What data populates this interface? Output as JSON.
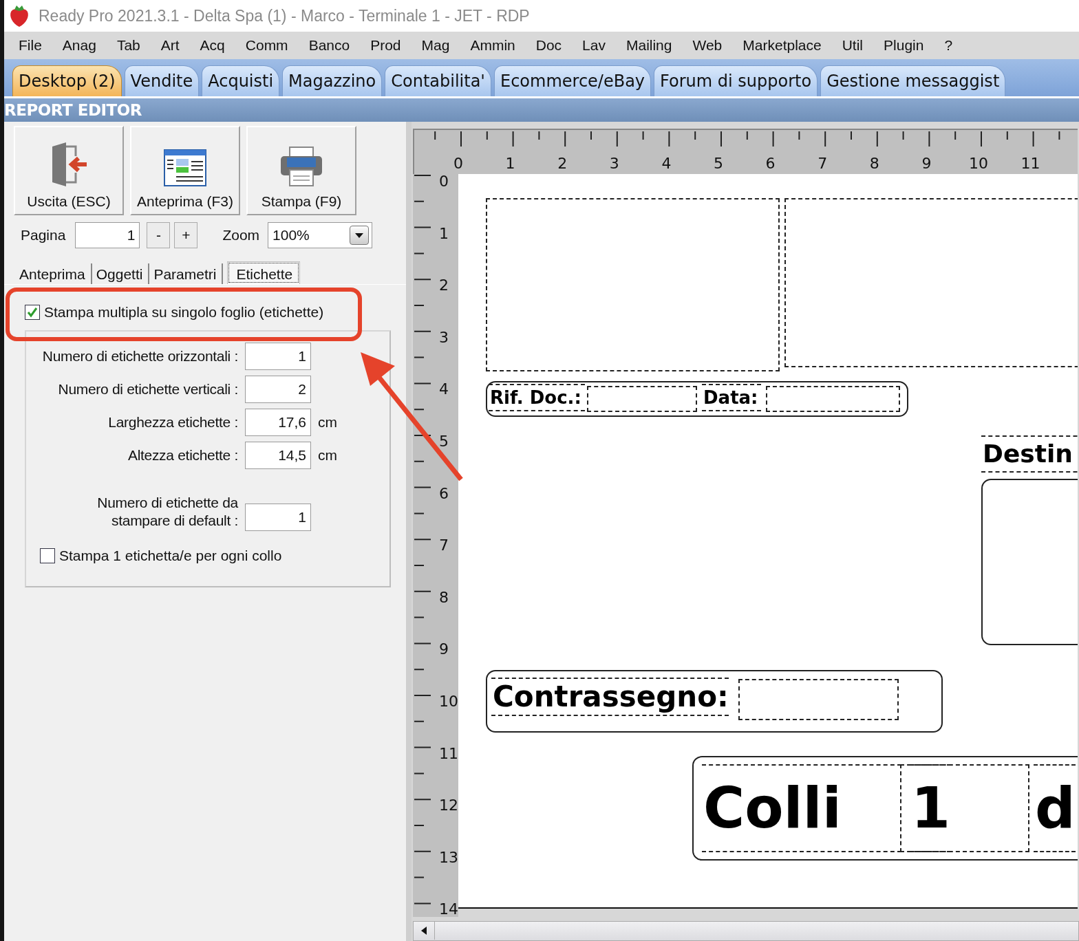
{
  "window": {
    "title": "Ready Pro 2021.3.1 - Delta Spa (1) - Marco - Terminale 1 - JET - RDP"
  },
  "menu": [
    "File",
    "Anag",
    "Tab",
    "Art",
    "Acq",
    "Comm",
    "Banco",
    "Prod",
    "Mag",
    "Ammin",
    "Doc",
    "Lav",
    "Mailing",
    "Web",
    "Marketplace",
    "Util",
    "Plugin",
    "?"
  ],
  "tabs": [
    {
      "label": "Desktop (2)",
      "selected": true
    },
    {
      "label": "Vendite",
      "selected": false
    },
    {
      "label": "Acquisti",
      "selected": false
    },
    {
      "label": "Magazzino",
      "selected": false
    },
    {
      "label": "Contabilita'",
      "selected": false
    },
    {
      "label": "Ecommerce/eBay",
      "selected": false
    },
    {
      "label": "Forum di supporto",
      "selected": false
    },
    {
      "label": "Gestione messaggist",
      "selected": false
    }
  ],
  "section_title": "REPORT EDITOR",
  "toolbar": [
    {
      "kind": "exit",
      "label": "Uscita (ESC)"
    },
    {
      "kind": "preview",
      "label": "Anteprima (F3)"
    },
    {
      "kind": "print",
      "label": "Stampa (F9)"
    }
  ],
  "page_controls": {
    "page_label": "Pagina",
    "page_value": "1",
    "decrement": "-",
    "increment": "+",
    "zoom_label": "Zoom",
    "zoom_value": "100%"
  },
  "panel_tabs": [
    {
      "label": "Anteprima",
      "selected": false
    },
    {
      "label": "Oggetti",
      "selected": false
    },
    {
      "label": "Parametri",
      "selected": false
    },
    {
      "label": "Etichette",
      "selected": true
    }
  ],
  "multi_print": {
    "label": "Stampa multipla su singolo foglio (etichette)",
    "checked": true
  },
  "label_fields": [
    {
      "label": "Numero di etichette orizzontali :",
      "value": "1"
    },
    {
      "label": "Numero di etichette verticali :",
      "value": "2"
    },
    {
      "label": "Larghezza etichette :",
      "value": "17,6",
      "unit": "cm"
    },
    {
      "label": "Altezza etichette :",
      "value": "14,5",
      "unit": "cm"
    },
    {
      "label": "Numero di etichette da\nstampare di default :",
      "value": "1"
    }
  ],
  "per_package": {
    "label": "Stampa 1 etichetta/e per ogni collo",
    "checked": false
  },
  "ruler": {
    "horizontal": [
      "0",
      "1",
      "2",
      "3",
      "4",
      "5",
      "6",
      "7",
      "8",
      "9",
      "10",
      "11"
    ],
    "vertical": [
      "0",
      "1",
      "2",
      "3",
      "4",
      "5",
      "6",
      "7",
      "8",
      "9",
      "10",
      "11",
      "12",
      "13",
      "14"
    ]
  },
  "report_objects": [
    {
      "kind": "frame"
    },
    {
      "kind": "frame"
    },
    {
      "kind": "group"
    },
    {
      "kind": "text",
      "text": "Rif. Doc.:"
    },
    {
      "kind": "frame"
    },
    {
      "kind": "text",
      "text": "Data:"
    },
    {
      "kind": "frame"
    },
    {
      "kind": "text",
      "text": "Destin"
    },
    {
      "kind": "group"
    },
    {
      "kind": "group"
    },
    {
      "kind": "text",
      "text": "Contrassegno:"
    },
    {
      "kind": "frame"
    },
    {
      "kind": "group"
    },
    {
      "kind": "text",
      "text": "Colli"
    },
    {
      "kind": "frame"
    },
    {
      "kind": "text",
      "text": "1"
    },
    {
      "kind": "text",
      "text": "d"
    }
  ]
}
